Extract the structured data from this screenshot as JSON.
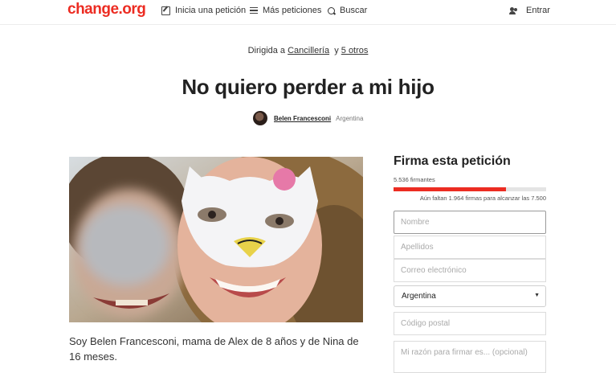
{
  "header": {
    "logo": "change.org",
    "nav": {
      "start_petition": "Inicia una petición",
      "more_petitions": "Más peticiones",
      "search": "Buscar",
      "login": "Entrar"
    }
  },
  "petition": {
    "directed_prefix": "Dirigida a",
    "directed_target": "Cancillería",
    "directed_and": "y",
    "directed_others": "5 otros",
    "title": "No quiero perder a mi hijo",
    "author": "Belen Francesconi",
    "country": "Argentina",
    "description": "Soy Belen Francesconi, mama de Alex de 8 años y de Nina de 16 meses."
  },
  "sign": {
    "heading": "Firma esta petición",
    "signers_text": "5.536 firmantes",
    "signers": 5536,
    "goal": 7500,
    "progress_fraction": 0.738,
    "remaining_text": "Aún faltan 1.964 firmas para alcanzar las 7.500",
    "placeholders": {
      "name": "Nombre",
      "surname": "Apellidos",
      "email": "Correo electrónico",
      "postal": "Código postal",
      "reason": "Mi razón para firmar es... (opcional)"
    },
    "country_selected": "Argentina"
  },
  "colors": {
    "brand": "#ec2c22"
  },
  "icons": [
    "edit-icon",
    "list-icon",
    "search-icon",
    "users-icon",
    "chevron-down-icon"
  ]
}
